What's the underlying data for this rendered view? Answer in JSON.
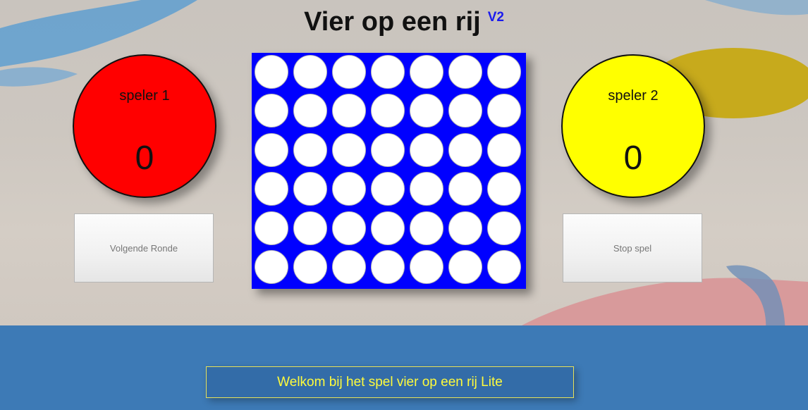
{
  "app": {
    "title": "Vier op een rij",
    "version": "V2"
  },
  "players": [
    {
      "name": "speler 1",
      "score": "0",
      "color": "#ff0000"
    },
    {
      "name": "speler 2",
      "score": "0",
      "color": "#ffff00"
    }
  ],
  "buttons": {
    "next_round": "Volgende Ronde",
    "stop": "Stop spel"
  },
  "board": {
    "columns": 7,
    "rows": 6,
    "background": "#0000ff",
    "empty_cell_color": "#ffffff"
  },
  "message": "Welkom bij het spel vier op een rij Lite"
}
